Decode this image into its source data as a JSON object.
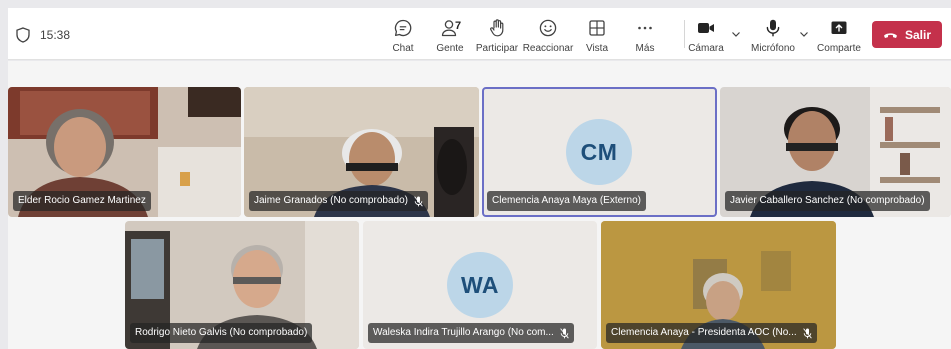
{
  "theme": {
    "accent": "#5b5fc7",
    "leave": "#c4314b",
    "avatar_bg": "#bcd6e8",
    "avatar_fg": "#1e4f7a"
  },
  "status": {
    "time": "15:38"
  },
  "toolbar": {
    "chat": {
      "label": "Chat",
      "icon": "chat-icon"
    },
    "people": {
      "label": "Gente",
      "count": "7",
      "icon": "people-icon"
    },
    "raise_hand": {
      "label": "Participar",
      "icon": "hand-icon"
    },
    "react": {
      "label": "Reaccionar",
      "icon": "smile-icon"
    },
    "view": {
      "label": "Vista",
      "icon": "grid-icon"
    },
    "more": {
      "label": "Más",
      "icon": "more-icon"
    },
    "camera": {
      "label": "Cámara",
      "icon": "camera-icon"
    },
    "mic": {
      "label": "Micrófono",
      "icon": "microphone-icon"
    },
    "share": {
      "label": "Comparte",
      "icon": "share-icon"
    },
    "leave": {
      "label": "Salir",
      "icon": "phone-hangup-icon"
    }
  },
  "participants": [
    {
      "name": "Elder Rocio Gamez Martinez",
      "muted": false,
      "video": true
    },
    {
      "name": "Jaime Granados (No comprobado)",
      "muted": true,
      "video": true
    },
    {
      "name": "Clemencia Anaya Maya (Externo)",
      "muted": false,
      "video": false,
      "initials": "CM",
      "active_speaker": true
    },
    {
      "name": "Javier Caballero Sanchez (No comprobado)",
      "muted": false,
      "video": true
    },
    {
      "name": "Rodrigo Nieto Galvis (No comprobado)",
      "muted": false,
      "video": true
    },
    {
      "name": "Waleska Indira Trujillo Arango (No com...",
      "muted": true,
      "video": false,
      "initials": "WA"
    },
    {
      "name": "Clemencia Anaya - Presidenta AOC (No...",
      "muted": true,
      "video": true
    }
  ]
}
